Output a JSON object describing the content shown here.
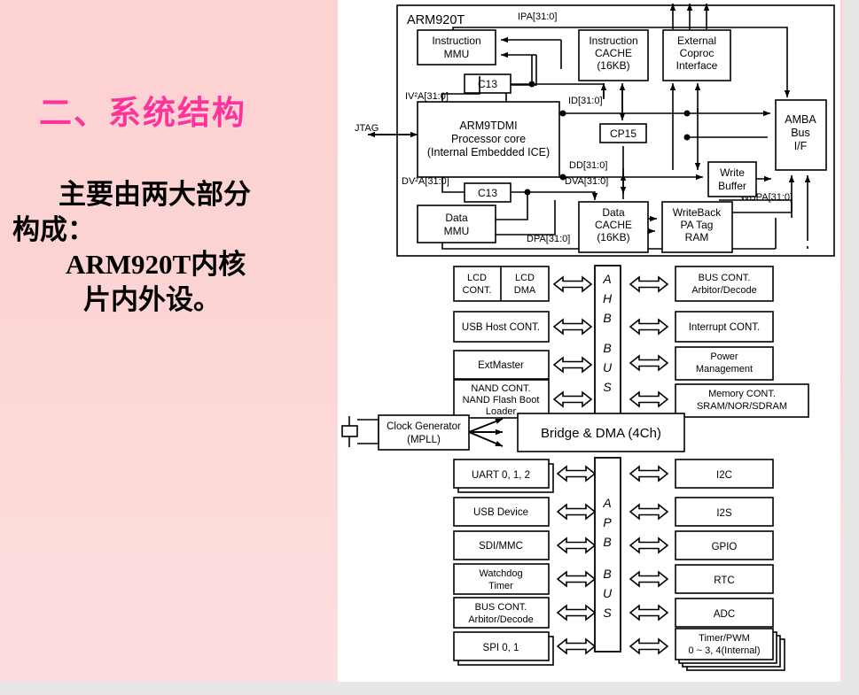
{
  "slide": {
    "title": "二、系统结构",
    "title_color": "#ff3399",
    "body_lines": [
      "主要由两大部分",
      "构成：",
      "ARM920T内核",
      "片内外设。"
    ]
  },
  "diagram": {
    "core_group_label": "ARM920T",
    "core_blocks": {
      "instruction_mmu": "Instruction\nMMU",
      "instruction_cache": "Instruction\nCACHE\n(16KB)",
      "external_coproc": "External\nCoproc\nInterface",
      "amba_bus_if": "AMBA\nBus\nI/F",
      "processor_core": "ARM9TDMI\nProcessor core\n(Internal Embedded ICE)",
      "cp15": "CP15",
      "write_buffer": "Write\nBuffer",
      "data_mmu": "Data\nMMU",
      "data_cache": "Data\nCACHE\n(16KB)",
      "writeback_pa_tag_ram": "WriteBack\nPA Tag\nRAM",
      "c13_upper": "C13",
      "c13_lower": "C13"
    },
    "core_labels": {
      "ipa": "IPA[31:0]",
      "iv2a": "IV²A[31:0]",
      "id": "ID[31:0]",
      "jtag": "JTAG",
      "dd": "DD[31:0]",
      "dv2a": "DV²A[31:0]",
      "dva": "DVA[31:0]",
      "wbpa": "WBPA[31:0]",
      "dpa": "DPA[31:0]"
    },
    "ahb": {
      "bus_label": "AHB BUS",
      "bus_letters": [
        "A",
        "H",
        "B",
        "B",
        "U",
        "S"
      ],
      "left": [
        {
          "label": "LCD CONT.",
          "label2": "LCD DMA",
          "split": true
        },
        {
          "label": "USB Host CONT."
        },
        {
          "label": "ExtMaster"
        },
        {
          "label": "NAND CONT.\nNAND Flash Boot\nLoader"
        }
      ],
      "right": [
        {
          "label": "BUS CONT.\nArbitor/Decode"
        },
        {
          "label": "Interrupt CONT."
        },
        {
          "label": "Power\nManagement"
        },
        {
          "label": "Memory CONT.\nSRAM/NOR/SDRAM"
        }
      ]
    },
    "middle": {
      "clock_generator": "Clock Generator\n(MPLL)",
      "bridge_dma": "Bridge & DMA (4Ch)",
      "crystal_icon": "crystal-oscillator-icon"
    },
    "apb": {
      "bus_label": "APB BUS",
      "bus_letters": [
        "A",
        "P",
        "B",
        "B",
        "U",
        "S"
      ],
      "left": [
        {
          "label": "UART 0, 1, 2",
          "stacked": true
        },
        {
          "label": "USB Device"
        },
        {
          "label": "SDI/MMC"
        },
        {
          "label": "Watchdog\nTimer"
        },
        {
          "label": "BUS CONT.\nArbitor/Decode"
        },
        {
          "label": "SPI 0, 1",
          "stacked": true
        }
      ],
      "right": [
        {
          "label": "I2C"
        },
        {
          "label": "I2S"
        },
        {
          "label": "GPIO"
        },
        {
          "label": "RTC"
        },
        {
          "label": "ADC"
        },
        {
          "label": "Timer/PWM\n0 ~ 3, 4(Internal)",
          "stacked": true
        }
      ]
    }
  }
}
